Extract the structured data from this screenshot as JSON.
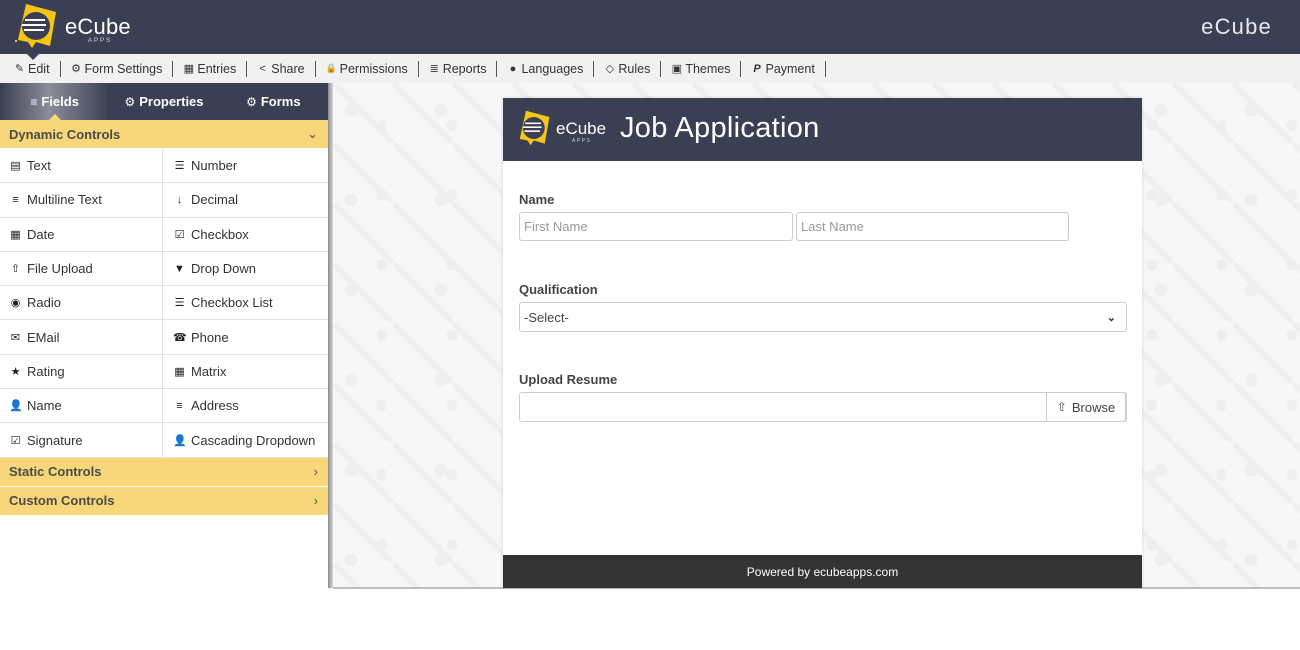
{
  "header": {
    "logo_text": "eCube",
    "logo_subtext": "APPS",
    "brand_right": "eCube"
  },
  "menu": [
    {
      "label": "Edit",
      "icon": "edit-icon",
      "glyph": "✎",
      "active": true
    },
    {
      "label": "Form Settings",
      "icon": "gear-icon",
      "glyph": "⚙"
    },
    {
      "label": "Entries",
      "icon": "table-icon",
      "glyph": "▦"
    },
    {
      "label": "Share",
      "icon": "share-icon",
      "glyph": "<"
    },
    {
      "label": "Permissions",
      "icon": "lock-icon",
      "glyph": "🔒"
    },
    {
      "label": "Reports",
      "icon": "database-icon",
      "glyph": "≣"
    },
    {
      "label": "Languages",
      "icon": "language-icon",
      "glyph": "●"
    },
    {
      "label": "Rules",
      "icon": "code-icon",
      "glyph": "◇"
    },
    {
      "label": "Themes",
      "icon": "theme-icon",
      "glyph": "▣"
    },
    {
      "label": "Payment",
      "icon": "paypal-icon",
      "glyph": "P"
    }
  ],
  "panel": {
    "tabs": [
      {
        "label": "Fields",
        "glyph": "≡",
        "active": true
      },
      {
        "label": "Properties",
        "glyph": "⚙"
      },
      {
        "label": "Forms",
        "glyph": "⚙"
      }
    ],
    "dynamic_controls": {
      "title": "Dynamic Controls",
      "expanded": true,
      "items": [
        {
          "label": "Text",
          "icon": "file-text-icon",
          "glyph": "▤"
        },
        {
          "label": "Number",
          "icon": "ordered-list-icon",
          "glyph": "☰"
        },
        {
          "label": "Multiline Text",
          "icon": "align-justify-icon",
          "glyph": "≡"
        },
        {
          "label": "Decimal",
          "icon": "sort-numeric-icon",
          "glyph": "↓"
        },
        {
          "label": "Date",
          "icon": "calendar-icon",
          "glyph": "▦"
        },
        {
          "label": "Checkbox",
          "icon": "checkbox-icon",
          "glyph": "☑"
        },
        {
          "label": "File Upload",
          "icon": "upload-icon",
          "glyph": "⇧"
        },
        {
          "label": "Drop Down",
          "icon": "caret-square-down-icon",
          "glyph": "▼"
        },
        {
          "label": "Radio",
          "icon": "radio-icon",
          "glyph": "◉"
        },
        {
          "label": "Checkbox List",
          "icon": "list-icon",
          "glyph": "☰"
        },
        {
          "label": "EMail",
          "icon": "envelope-icon",
          "glyph": "✉"
        },
        {
          "label": "Phone",
          "icon": "phone-icon",
          "glyph": "☎"
        },
        {
          "label": "Rating",
          "icon": "star-icon",
          "glyph": "★"
        },
        {
          "label": "Matrix",
          "icon": "table-icon",
          "glyph": "▦"
        },
        {
          "label": "Name",
          "icon": "user-icon",
          "glyph": "👤"
        },
        {
          "label": "Address",
          "icon": "align-justify-icon",
          "glyph": "≡"
        },
        {
          "label": "Signature",
          "icon": "checkbox-icon",
          "glyph": "☑"
        },
        {
          "label": "Cascading Dropdown",
          "icon": "user-icon",
          "glyph": "👤"
        }
      ]
    },
    "static_controls": {
      "title": "Static Controls",
      "expanded": false
    },
    "custom_controls": {
      "title": "Custom Controls",
      "expanded": false
    }
  },
  "form": {
    "logo_text": "eCube",
    "logo_subtext": "APPS",
    "title": "Job Application",
    "name_label": "Name",
    "first_name_placeholder": "First Name",
    "last_name_placeholder": "Last Name",
    "qualification_label": "Qualification",
    "qualification_value": "-Select-",
    "upload_label": "Upload Resume",
    "browse_label": "Browse",
    "footer": "Powered by ecubeapps.com"
  },
  "colors": {
    "header_bg": "#3b3f54",
    "accent_yellow": "#f7d77a",
    "footer_bg": "#333333"
  }
}
